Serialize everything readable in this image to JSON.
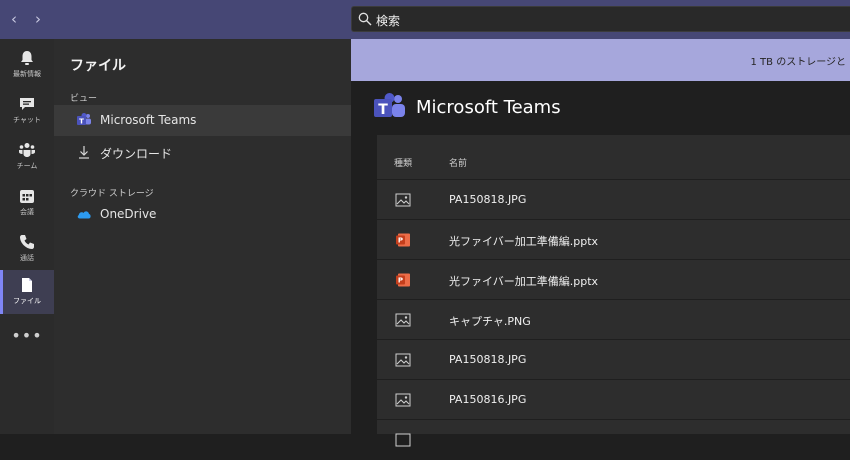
{
  "search": {
    "placeholder": "検索"
  },
  "rail": {
    "items": [
      {
        "label": "最新情報",
        "icon": "bell-icon"
      },
      {
        "label": "チャット",
        "icon": "chat-icon"
      },
      {
        "label": "チーム",
        "icon": "teams-icon"
      },
      {
        "label": "会議",
        "icon": "calendar-icon"
      },
      {
        "label": "通話",
        "icon": "phone-icon"
      },
      {
        "label": "ファイル",
        "icon": "file-icon",
        "active": true
      }
    ],
    "more": "•••"
  },
  "sidebar": {
    "title": "ファイル",
    "view_section": "ビュー",
    "view_items": [
      {
        "label": "Microsoft Teams",
        "icon": "teams-logo-icon",
        "selected": true
      },
      {
        "label": "ダウンロード",
        "icon": "download-icon"
      }
    ],
    "cloud_section": "クラウド ストレージ",
    "cloud_items": [
      {
        "label": "OneDrive",
        "icon": "onedrive-icon"
      }
    ]
  },
  "main": {
    "banner_text": "1 TB のストレージと",
    "title": "Microsoft Teams",
    "columns": {
      "type": "種類",
      "name": "名前"
    },
    "files": [
      {
        "name": "PA150818.JPG",
        "type": "image"
      },
      {
        "name": "光ファイバー加工準備編.pptx",
        "type": "powerpoint"
      },
      {
        "name": "光ファイバー加工準備編.pptx",
        "type": "powerpoint"
      },
      {
        "name": "キャプチャ.PNG",
        "type": "image"
      },
      {
        "name": "PA150818.JPG",
        "type": "image"
      },
      {
        "name": "PA150816.JPG",
        "type": "image"
      }
    ]
  },
  "colors": {
    "titlebar": "#464775",
    "accent": "#7f85f5",
    "banner": "#a6a7dc",
    "powerpoint": "#c43e1c"
  }
}
